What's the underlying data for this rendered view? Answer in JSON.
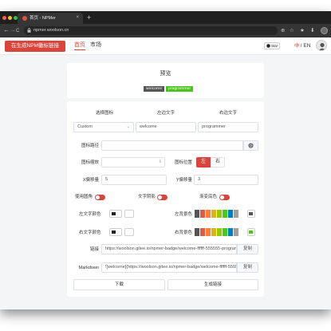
{
  "browser": {
    "tab_title": "首页 - NPMer",
    "tab_close": "×",
    "new_tab": "+",
    "url": "npmer.woolson.cn",
    "nav_back": "←",
    "nav_forward": "→",
    "nav_reload": "C",
    "nav_home": "⌂",
    "toolbar_icons": [
      "⊕",
      "☆",
      "★",
      "⬇"
    ]
  },
  "header": {
    "cta_label": "在生成NPM徽标链接",
    "nav_home": "首页",
    "nav_market": "市场",
    "star_label": "Star",
    "lang_zh": "中",
    "lang_rest": " / EN"
  },
  "preview": {
    "title": "预览",
    "left_badge": "welcome",
    "right_badge": "programmer",
    "left_color": "#555555",
    "right_color": "#4bc51d"
  },
  "form": {
    "col_icon": "选择图标",
    "col_left": "左边文字",
    "col_right": "右边文字",
    "icon_select_value": "Custom",
    "left_text_value": "welcome",
    "right_text_value": "programmer",
    "icon_path_label": "图标路径",
    "icon_path_value": "",
    "icon_path_addon": "?",
    "icon_scale_label": "图标缩放",
    "icon_scale_value": "",
    "icon_pos_label": "图标位置",
    "icon_pos_left": "左",
    "icon_pos_right": "右",
    "x_offset_label": "X偏移量",
    "x_offset_value": "5",
    "y_offset_label": "Y偏移量",
    "y_offset_value": "3",
    "rounded_label": "使用圆角",
    "shadow_label": "文字阴影",
    "gradient_label": "渐变底色",
    "left_text_color_label": "左文字颜色",
    "left_bg_color_label": "左背景色",
    "right_text_color_label": "右文字颜色",
    "right_bg_color_label": "右背景色",
    "link_label": "链接",
    "link_value": "https://woolson.gitee.io/npmer-badge/welcome-ffffff-555555-program",
    "markdown_label": "Markdown",
    "markdown_value": "![welcome](https://woolson.gitee.io/npmer-badge/welcome-ffffff-55555",
    "copy_label": "复制",
    "download_label": "下载",
    "generate_label": "生成链接"
  },
  "colors": {
    "accent": "#d9453b",
    "left_bg_swatches": [
      "#555555",
      "#e05d44",
      "#fe7d37",
      "#dfb317",
      "#97ca00",
      "#4c1",
      "#a4a61d",
      "#007ec6",
      "#9f9f9f"
    ],
    "right_bg_swatches": [
      "#555555",
      "#e05d44",
      "#fe7d37",
      "#dfb317",
      "#97ca00",
      "#4c1",
      "#007ec6",
      "#9f9f9f",
      "#4bc51d"
    ]
  }
}
